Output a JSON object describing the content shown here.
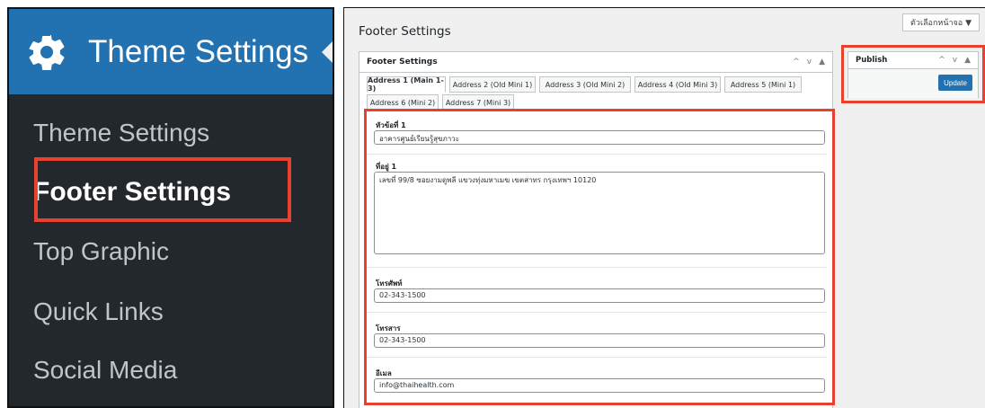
{
  "sidebar": {
    "header_title": "Theme Settings",
    "items": [
      {
        "label": "Theme Settings"
      },
      {
        "label": "Footer Settings"
      },
      {
        "label": "Top Graphic"
      },
      {
        "label": "Quick Links"
      },
      {
        "label": "Social Media"
      }
    ]
  },
  "screen_options": "ตัวเลือกหน้าจอ ▼",
  "page": {
    "title": "Footer Settings"
  },
  "footer_box": {
    "title": "Footer Settings",
    "controls": [
      "^",
      "v",
      "▲"
    ],
    "tabs": [
      {
        "label": "Address 1 (Main 1-3)"
      },
      {
        "label": "Address 2 (Old Mini 1)"
      },
      {
        "label": "Address 3 (Old Mini 2)"
      },
      {
        "label": "Address 4 (Old Mini 3)"
      },
      {
        "label": "Address 5 (Mini 1)"
      },
      {
        "label": "Address 6 (Mini 2)"
      },
      {
        "label": "Address 7 (Mini 3)"
      }
    ],
    "fields": {
      "heading_label": "หัวข้อที่ 1",
      "heading_value": "อาคารศูนย์เรียนรู้สุขภาวะ",
      "address_label": "ที่อยู่ 1",
      "address_value": "เลขที่ 99/8 ซอยงามดูพลี แขวงทุ่งมหาเมฆ เขตสาทร กรุงเทพฯ 10120",
      "phone_label": "โทรศัพท์",
      "phone_value": "02-343-1500",
      "fax_label": "โทรสาร",
      "fax_value": "02-343-1500",
      "email_label": "อีเมล",
      "email_value": "info@thaihealth.com"
    }
  },
  "publish_box": {
    "title": "Publish",
    "controls": [
      "^",
      "v",
      "▲"
    ],
    "update_label": "Update"
  },
  "colors": {
    "sidebar_bg": "#23282d",
    "header_bg": "#2271b1",
    "highlight": "#e8412f",
    "button": "#2271b1"
  }
}
